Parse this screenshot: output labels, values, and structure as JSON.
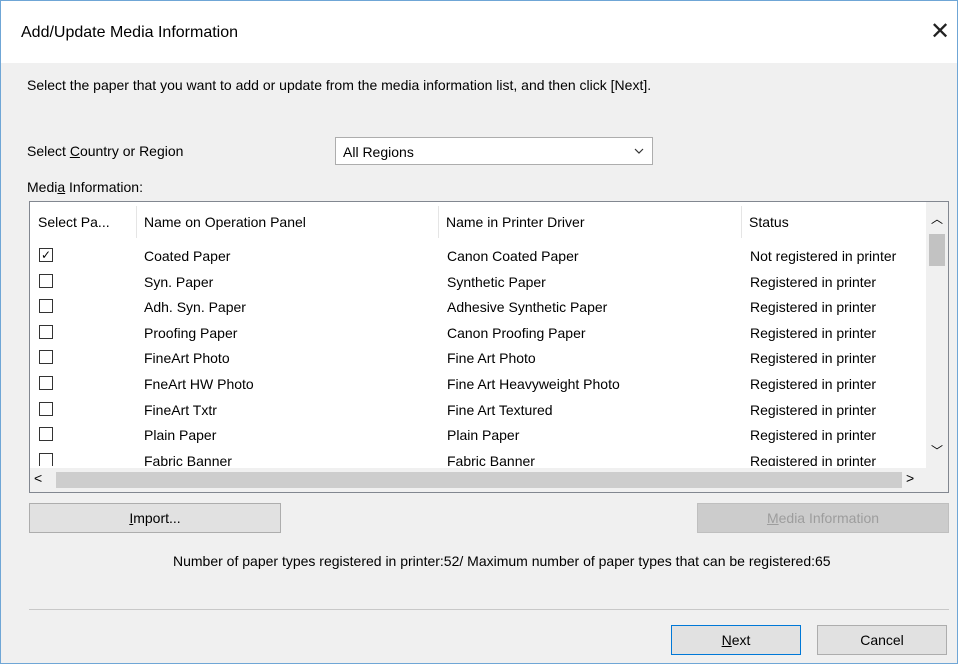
{
  "window": {
    "title": "Add/Update Media Information",
    "close_glyph": "✕"
  },
  "instruction": "Select the paper that you want to add or update from the media information list, and then click [Next].",
  "region": {
    "label_pre": "Select ",
    "label_ul": "C",
    "label_post": "ountry or Region",
    "selected": "All Regions"
  },
  "media_label": {
    "pre": "Medi",
    "ul": "a",
    "post": " Information:"
  },
  "list": {
    "columns": [
      "Select Pa...",
      "Name on Operation Panel",
      "Name in Printer Driver",
      "Status"
    ],
    "rows": [
      {
        "checked": true,
        "panel": "Coated Paper",
        "driver": "Canon Coated Paper",
        "status": "Not registered in printer"
      },
      {
        "checked": false,
        "panel": "Syn. Paper",
        "driver": "Synthetic Paper",
        "status": "Registered in printer"
      },
      {
        "checked": false,
        "panel": "Adh. Syn. Paper",
        "driver": "Adhesive Synthetic Paper",
        "status": "Registered in printer"
      },
      {
        "checked": false,
        "panel": "Proofing Paper",
        "driver": "Canon Proofing Paper",
        "status": "Registered in printer"
      },
      {
        "checked": false,
        "panel": "FineArt Photo",
        "driver": "Fine Art Photo",
        "status": "Registered in printer"
      },
      {
        "checked": false,
        "panel": "FneArt HW Photo",
        "driver": "Fine Art Heavyweight Photo",
        "status": "Registered in printer"
      },
      {
        "checked": false,
        "panel": "FineArt Txtr",
        "driver": "Fine Art Textured",
        "status": "Registered in printer"
      },
      {
        "checked": false,
        "panel": "Plain Paper",
        "driver": "Plain Paper",
        "status": "Registered in printer"
      },
      {
        "checked": false,
        "panel": "Fabric Banner",
        "driver": "Fabric Banner",
        "status": "Registered in printer"
      }
    ]
  },
  "buttons": {
    "import_ul": "I",
    "import_post": "mport...",
    "media_info_ul": "M",
    "media_info_post": "edia Information",
    "next_ul": "N",
    "next_post": "ext",
    "cancel": "Cancel"
  },
  "count_text": "Number of paper types registered in printer:52/ Maximum number of paper types that can be registered:65",
  "icons": {
    "checkmark": "☑",
    "up": "︿",
    "down": "﹀",
    "left": "<",
    "right": ">"
  }
}
